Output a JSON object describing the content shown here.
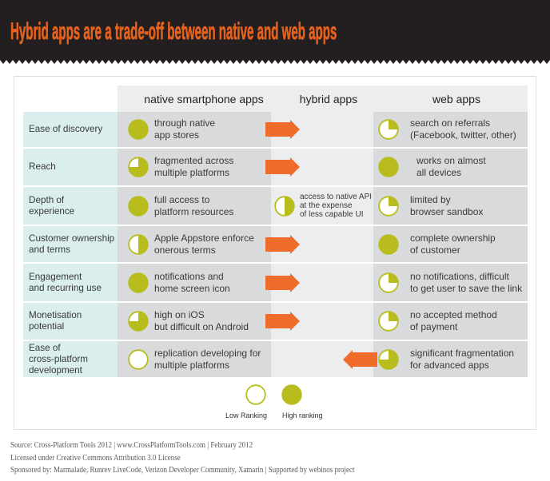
{
  "chart_data": {
    "type": "table",
    "title": "Hybrid apps are a trade-off between native and web apps",
    "columns": {
      "native": "native smartphone apps",
      "hybrid": "hybrid apps",
      "web": "web apps"
    },
    "rank_scale": [
      0,
      0.25,
      0.5,
      0.75,
      1
    ],
    "rows": [
      {
        "label": "Ease of discovery",
        "native": {
          "rank": 1,
          "text": "through native\napp stores"
        },
        "hybrid": null,
        "arrow": "right",
        "web": {
          "rank": 0.25,
          "text": "search on referrals\n(Facebook, twitter, other)"
        }
      },
      {
        "label": "Reach",
        "native": {
          "rank": 0.75,
          "text": "fragmented across\nmultiple platforms"
        },
        "hybrid": null,
        "arrow": "right",
        "web": {
          "rank": 1,
          "text": "works on almost\nall devices"
        }
      },
      {
        "label": "Depth of\nexperience",
        "native": {
          "rank": 1,
          "text": "full access to\nplatform resources"
        },
        "hybrid": {
          "rank": 0.5,
          "text": "access to native API\nat the expense\nof less capable UI"
        },
        "arrow": null,
        "web": {
          "rank": 0.25,
          "text": "limited by\nbrowser sandbox"
        }
      },
      {
        "label": "Customer ownership\nand terms",
        "native": {
          "rank": 0.5,
          "text": "Apple Appstore enforce\nonerous terms"
        },
        "hybrid": null,
        "arrow": "right",
        "web": {
          "rank": 1,
          "text": "complete ownership\nof customer"
        }
      },
      {
        "label": "Engagement\nand recurring use",
        "native": {
          "rank": 1,
          "text": "notifications and\nhome screen icon"
        },
        "hybrid": null,
        "arrow": "right",
        "web": {
          "rank": 0.25,
          "text": "no notifications, difficult\nto get user to save the link"
        }
      },
      {
        "label": "Monetisation\npotential",
        "native": {
          "rank": 0.75,
          "text": "high on iOS\nbut difficult on Android"
        },
        "hybrid": null,
        "arrow": "right",
        "web": {
          "rank": 0.25,
          "text": "no accepted method\nof payment"
        }
      },
      {
        "label": "Ease of\ncross-platform\ndevelopment",
        "native": {
          "rank": 0,
          "text": "replication developing for\nmultiple platforms"
        },
        "hybrid": null,
        "arrow": "left",
        "web": {
          "rank": 0.75,
          "text": "significant fragmentation\nfor advanced apps"
        }
      }
    ],
    "legend": {
      "low": {
        "label": "Low Ranking",
        "rank": 0
      },
      "high": {
        "label": "High ranking",
        "rank": 1
      }
    }
  },
  "footer": {
    "lines": [
      "Source: Cross-Platform Tools 2012 | www.CrossPlatformTools.com | February 2012",
      "Licensed under Creative Commons Attribution 3.0 License",
      "Sponsored by: Marmalade, Runrev LiveCode, Verizon Developer Community, Xamarin | Supported by webinos project"
    ]
  },
  "colors": {
    "title_orange": "#e5621e",
    "arrow_orange": "#ef6c2b",
    "rank_green": "#b8bc1c",
    "header_bg": "#231f20",
    "label_bg": "#dbeeee",
    "cell_bg": "#d9dadb",
    "hybrid_bg": "#ecedee"
  }
}
